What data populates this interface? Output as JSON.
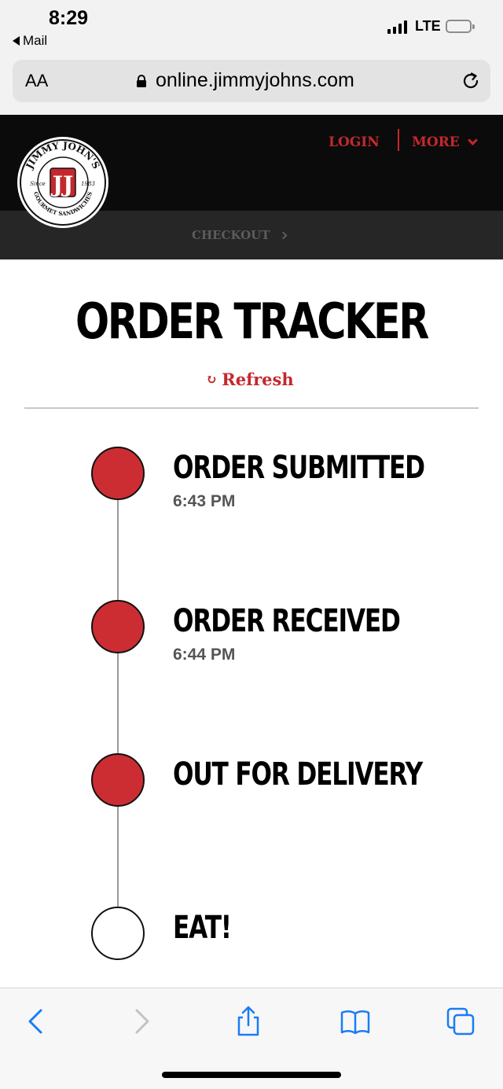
{
  "status_bar": {
    "time": "8:29",
    "back_app": "Mail",
    "network": "LTE"
  },
  "browser": {
    "text_size_label": "AA",
    "url": "online.jimmyjohns.com",
    "icons": [
      "lock-icon",
      "reload-icon",
      "back-icon",
      "forward-icon",
      "share-icon",
      "bookmarks-icon",
      "tabs-icon"
    ]
  },
  "site_header": {
    "logo": {
      "top_text": "JIMMY JOHN'S",
      "monogram": "JJ",
      "left_text": "Since",
      "right_text": "1983",
      "bottom_text": "GOURMET SANDWICHES"
    },
    "login_label": "LOGIN",
    "more_label": "MORE",
    "checkout_label": "CHECKOUT"
  },
  "page": {
    "title": "ORDER TRACKER",
    "refresh_icon": "↻",
    "refresh_label": "Refresh"
  },
  "steps": [
    {
      "label": "ORDER SUBMITTED",
      "time": "6:43 PM",
      "completed": true
    },
    {
      "label": "ORDER RECEIVED",
      "time": "6:44 PM",
      "completed": true
    },
    {
      "label": "OUT FOR DELIVERY",
      "time": "",
      "completed": true
    },
    {
      "label": "EAT!",
      "time": "",
      "completed": false
    }
  ],
  "colors": {
    "brand_red": "#cc2d33",
    "header_black": "#0b0b0b",
    "ios_blue": "#1a7cf5"
  }
}
